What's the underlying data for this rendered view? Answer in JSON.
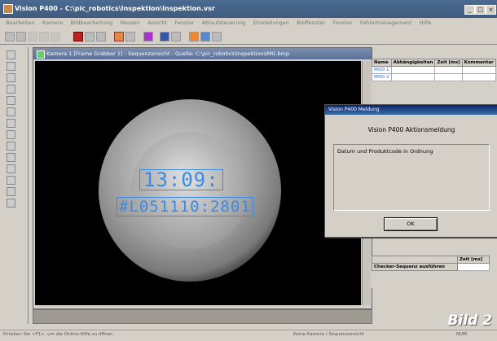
{
  "window": {
    "title": "Vision P400 - C:\\pic_robotics\\Inspektion\\Inspektion.vsr",
    "btn_min": "_",
    "btn_max": "□",
    "btn_close": "×"
  },
  "menu": [
    "Bearbeiten",
    "Kamera",
    "Bildbearbeitung",
    "Messen",
    "Ansicht",
    "Fenster",
    "Ablaufsteuerung",
    "Einstellungen",
    "Bildfenster",
    "Fenster",
    "Fehlermanagement",
    "Hilfe"
  ],
  "camera_window": {
    "title": "Kamera 1 [Frame Grabber 1] - Sequenzansicht - Quelle: C:\\pic_robotics\\Inspektion\\IMG.bmp"
  },
  "ocr": {
    "line1": "13:09:",
    "line2": "#L051110:2801"
  },
  "results_table": {
    "headers": [
      "Name",
      "Abhängigkeiten",
      "Zeit [ms]",
      "Kommentar"
    ],
    "rows": [
      [
        "MOD 1",
        "",
        "",
        ""
      ],
      [
        "MOD 2",
        "",
        "",
        ""
      ]
    ]
  },
  "dialog": {
    "title": "Vision P400 Meldung",
    "heading": "Vision P400 Aktionsmeldung",
    "message": "Datum und Produktcode in Ordnung",
    "ok_label": "OK"
  },
  "lower_table": {
    "headers": [
      "",
      "Zeit [ms]"
    ],
    "rows": [
      [
        "Checker-Sequenz ausführen",
        ""
      ]
    ]
  },
  "overlay_label": "Bild 2",
  "status": {
    "left": "Drücken Sie <F1>, um die Online-Hilfe zu öffnen.",
    "middle": "Keine Kamera / Sequenzansicht",
    "right": "NUM"
  }
}
